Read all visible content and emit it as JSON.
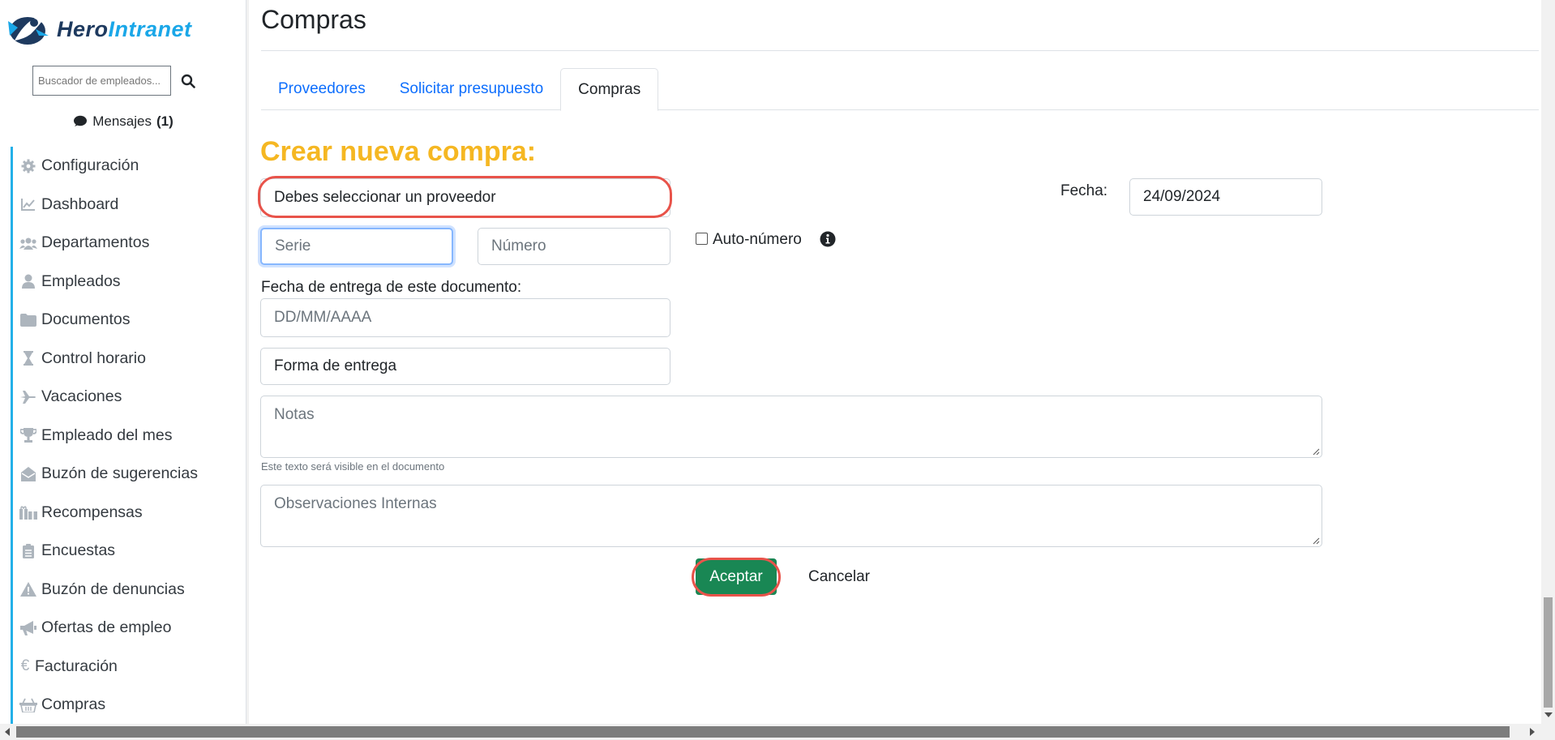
{
  "brand": {
    "name_part1": "Hero",
    "name_part2": "Intranet"
  },
  "sidebar": {
    "search_placeholder": "Buscador de empleados...",
    "messages_label": "Mensajes",
    "messages_count": "(1)",
    "items": [
      {
        "label": "Configuración",
        "icon": "gear-icon"
      },
      {
        "label": "Dashboard",
        "icon": "chart-line-icon"
      },
      {
        "label": "Departamentos",
        "icon": "users-icon"
      },
      {
        "label": "Empleados",
        "icon": "user-icon"
      },
      {
        "label": "Documentos",
        "icon": "folder-icon"
      },
      {
        "label": "Control horario",
        "icon": "hourglass-icon"
      },
      {
        "label": "Vacaciones",
        "icon": "plane-icon"
      },
      {
        "label": "Empleado del mes",
        "icon": "trophy-icon"
      },
      {
        "label": "Buzón de sugerencias",
        "icon": "envelope-open-icon"
      },
      {
        "label": "Recompensas",
        "icon": "gifts-icon"
      },
      {
        "label": "Encuestas",
        "icon": "clipboard-list-icon"
      },
      {
        "label": "Buzón de denuncias",
        "icon": "warning-icon"
      },
      {
        "label": "Ofertas de empleo",
        "icon": "megaphone-icon"
      },
      {
        "label": "Facturación",
        "icon": "euro-icon"
      },
      {
        "label": "Compras",
        "icon": "basket-icon"
      }
    ]
  },
  "page": {
    "title": "Compras",
    "tabs": [
      {
        "label": "Proveedores",
        "active": false
      },
      {
        "label": "Solicitar presupuesto",
        "active": false
      },
      {
        "label": "Compras",
        "active": true
      }
    ]
  },
  "form": {
    "heading": "Crear nueva compra:",
    "provider_value": "Debes seleccionar un proveedor",
    "date_label": "Fecha:",
    "date_value": "24/09/2024",
    "serie_placeholder": "Serie",
    "numero_placeholder": "Número",
    "autonumero_label": "Auto-número",
    "delivery_date_label": "Fecha de entrega de este documento:",
    "delivery_date_placeholder": "DD/MM/AAAA",
    "delivery_method_value": "Forma de entrega",
    "notes_placeholder": "Notas",
    "notes_hint": "Este texto será visible en el documento",
    "internal_notes_placeholder": "Observaciones Internas",
    "accept_label": "Aceptar",
    "cancel_label": "Cancelar"
  },
  "colors": {
    "accent_heading": "#f5b722",
    "link": "#0d6efd",
    "accept_button": "#198754",
    "annotation": "#e8534a",
    "sidebar_border": "#23b0e8"
  }
}
